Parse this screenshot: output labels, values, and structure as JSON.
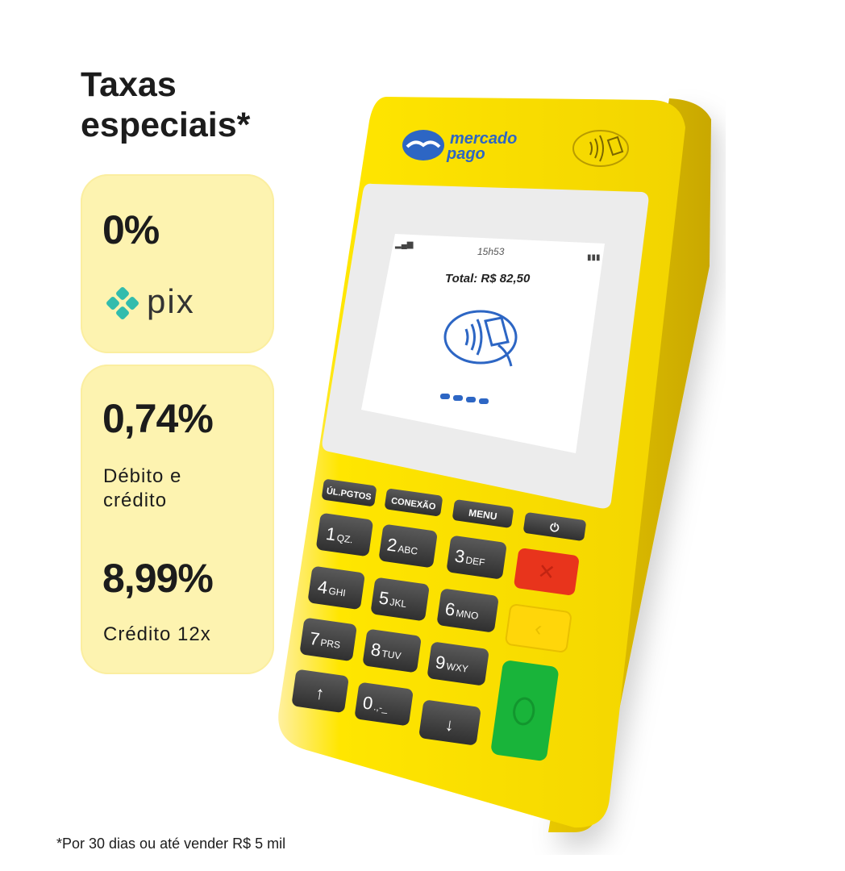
{
  "headline": {
    "line1": "Taxas",
    "line2": "especiais*"
  },
  "pix_card": {
    "rate": "0%",
    "brand": "pix"
  },
  "rates_card": {
    "debit_credit_rate": "0,74%",
    "debit_credit_label_line1": "Débito e",
    "debit_credit_label_line2": "crédito",
    "credit12_rate": "8,99%",
    "credit12_label": "Crédito 12x"
  },
  "footnote": "*Por 30 dias ou até vender R$ 5 mil",
  "device": {
    "brand_line1": "mercado",
    "brand_line2": "pago",
    "screen_time": "15h53",
    "screen_total": "Total: R$ 82,50",
    "keys": {
      "ult_pgtos": "ÚL.PGTOS",
      "conexao": "CONEXÃO",
      "menu": "MENU",
      "k1": "1",
      "k1s": "QZ.",
      "k2": "2",
      "k2s": "ABC",
      "k3": "3",
      "k3s": "DEF",
      "k4": "4",
      "k4s": "GHI",
      "k5": "5",
      "k5s": "JKL",
      "k6": "6",
      "k6s": "MNO",
      "k7": "7",
      "k7s": "PRS",
      "k8": "8",
      "k8s": "TUV",
      "k9": "9",
      "k9s": "WXY",
      "k0": "0",
      "k0s": ".,-_"
    }
  },
  "colors": {
    "device_yellow": "#ffe600",
    "card_bg": "#fdf3b0",
    "pix_teal": "#32bcad",
    "brand_blue": "#2d66c4",
    "cancel_red": "#e8341c",
    "confirm_green": "#19b43a"
  }
}
